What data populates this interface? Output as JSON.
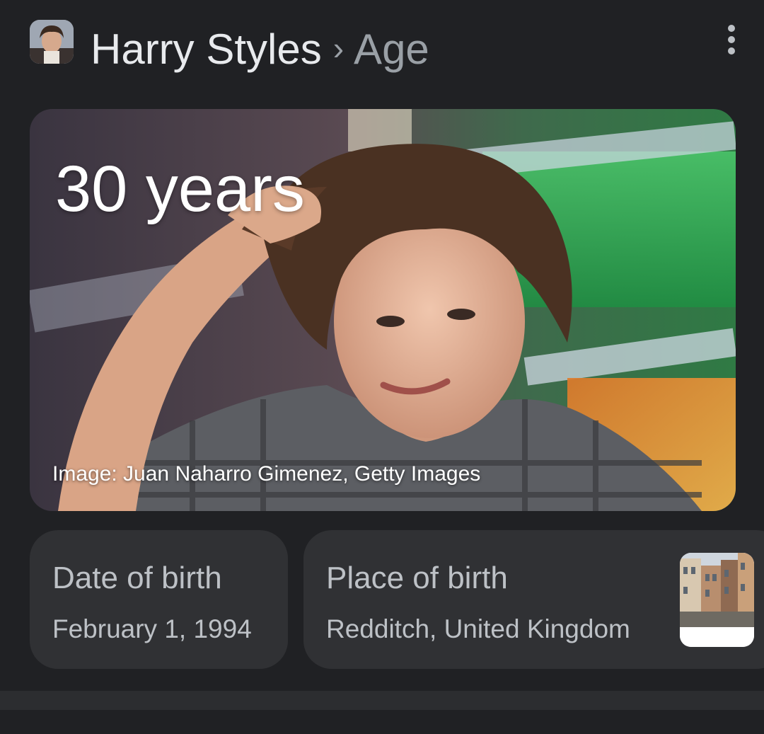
{
  "header": {
    "entity": "Harry Styles",
    "separator": "›",
    "attribute": "Age"
  },
  "hero": {
    "age_text": "30 years",
    "image_credit": "Image: Juan Naharro Gimenez, Getty Images"
  },
  "chips": {
    "date_of_birth": {
      "title": "Date of birth",
      "value": "February 1, 1994"
    },
    "place_of_birth": {
      "title": "Place of birth",
      "value": "Redditch, United Kingdom"
    }
  },
  "icons": {
    "more": "more-vert-icon",
    "entity_thumbnail": "avatar",
    "place_thumbnail": "town-street-photo"
  },
  "colors": {
    "background": "#202124",
    "chip_background": "#303134",
    "primary_text": "#e8eaed",
    "secondary_text": "#bdc1c6"
  }
}
